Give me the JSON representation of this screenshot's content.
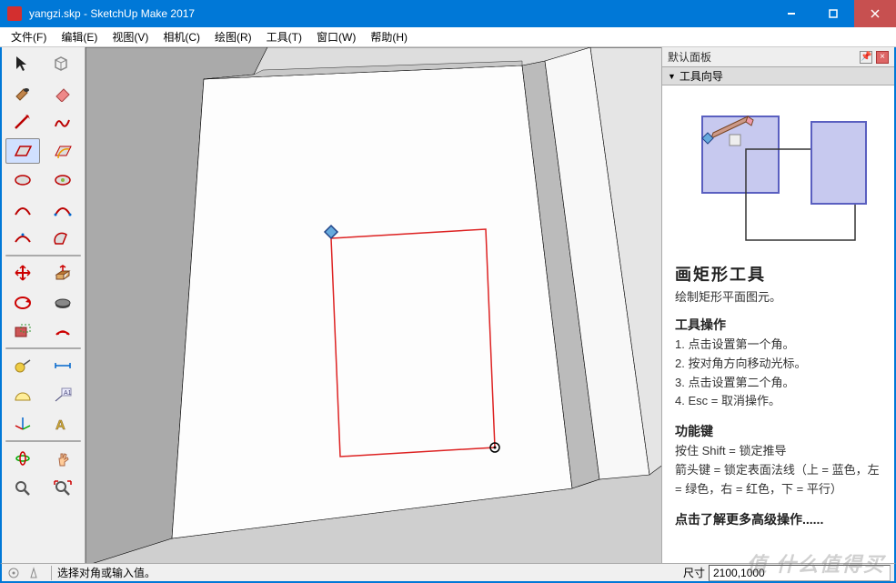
{
  "title": "yangzi.skp - SketchUp Make 2017",
  "menus": [
    "文件(F)",
    "编辑(E)",
    "视图(V)",
    "相机(C)",
    "绘图(R)",
    "工具(T)",
    "窗口(W)",
    "帮助(H)"
  ],
  "tray": {
    "panel_title": "默认面板",
    "section_title": "工具向导",
    "tool_title": "画矩形工具",
    "tool_desc": "绘制矩形平面图元。",
    "op_heading": "工具操作",
    "steps": [
      "1. 点击设置第一个角。",
      "2. 按对角方向移动光标。",
      "3. 点击设置第二个角。",
      "4. Esc = 取消操作。"
    ],
    "keys_heading": "功能键",
    "keys_text": "按住 Shift = 锁定推导\n箭头键 = 锁定表面法线（上 = 蓝色，左 = 绿色，右 = 红色，下 = 平行）",
    "more_link": "点击了解更多高级操作......"
  },
  "status": {
    "prompt": "选择对角或输入值。",
    "dim_label": "尺寸",
    "dim_value": "2100,1000"
  },
  "watermark": "值 什么值得买"
}
